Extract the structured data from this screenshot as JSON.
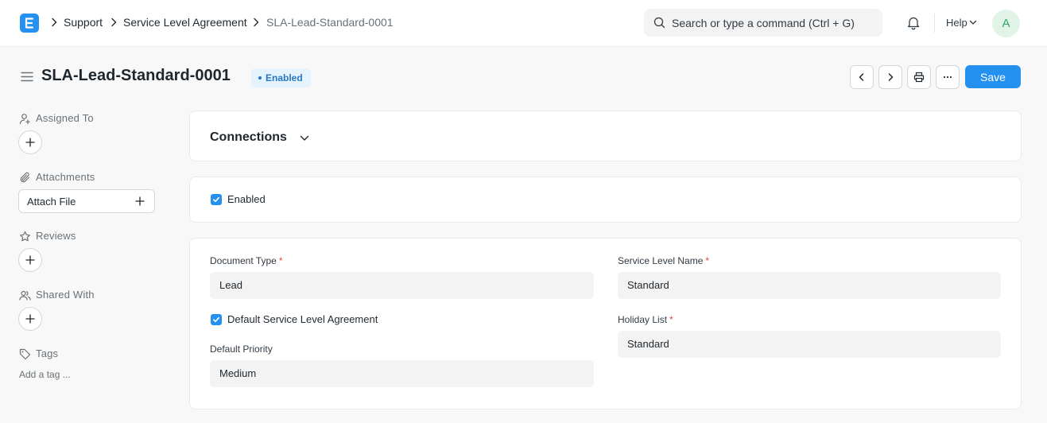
{
  "navbar": {
    "breadcrumbs": [
      "Support",
      "Service Level Agreement",
      "SLA-Lead-Standard-0001"
    ],
    "search_placeholder": "Search or type a command (Ctrl + G)",
    "help_label": "Help",
    "avatar_initial": "A"
  },
  "page": {
    "title": "SLA-Lead-Standard-0001",
    "status": "Enabled",
    "save_label": "Save"
  },
  "sidebar": {
    "assigned_to": "Assigned To",
    "attachments": "Attachments",
    "attach_file": "Attach File",
    "reviews": "Reviews",
    "shared_with": "Shared With",
    "tags": "Tags",
    "add_tag": "Add a tag ..."
  },
  "connections": {
    "title": "Connections"
  },
  "enabled_section": {
    "enabled_label": "Enabled",
    "enabled_checked": true
  },
  "form": {
    "document_type_label": "Document Type",
    "document_type_value": "Lead",
    "default_sla_label": "Default Service Level Agreement",
    "default_sla_checked": true,
    "default_priority_label": "Default Priority",
    "default_priority_value": "Medium",
    "service_level_name_label": "Service Level Name",
    "service_level_name_value": "Standard",
    "holiday_list_label": "Holiday List",
    "holiday_list_value": "Standard"
  },
  "colors": {
    "primary": "#2490ef",
    "required": "#e24c4c",
    "status_bg": "#e5f3fd",
    "status_text": "#2778c4"
  },
  "icons": [
    "app-logo-icon",
    "chevron-right-icon",
    "search-icon",
    "bell-icon",
    "chevron-down-icon",
    "hamburger-icon",
    "chevron-left-icon",
    "printer-icon",
    "ellipsis-icon",
    "user-plus-icon",
    "paperclip-icon",
    "star-icon",
    "users-icon",
    "tag-icon",
    "plus-icon",
    "check-icon"
  ]
}
